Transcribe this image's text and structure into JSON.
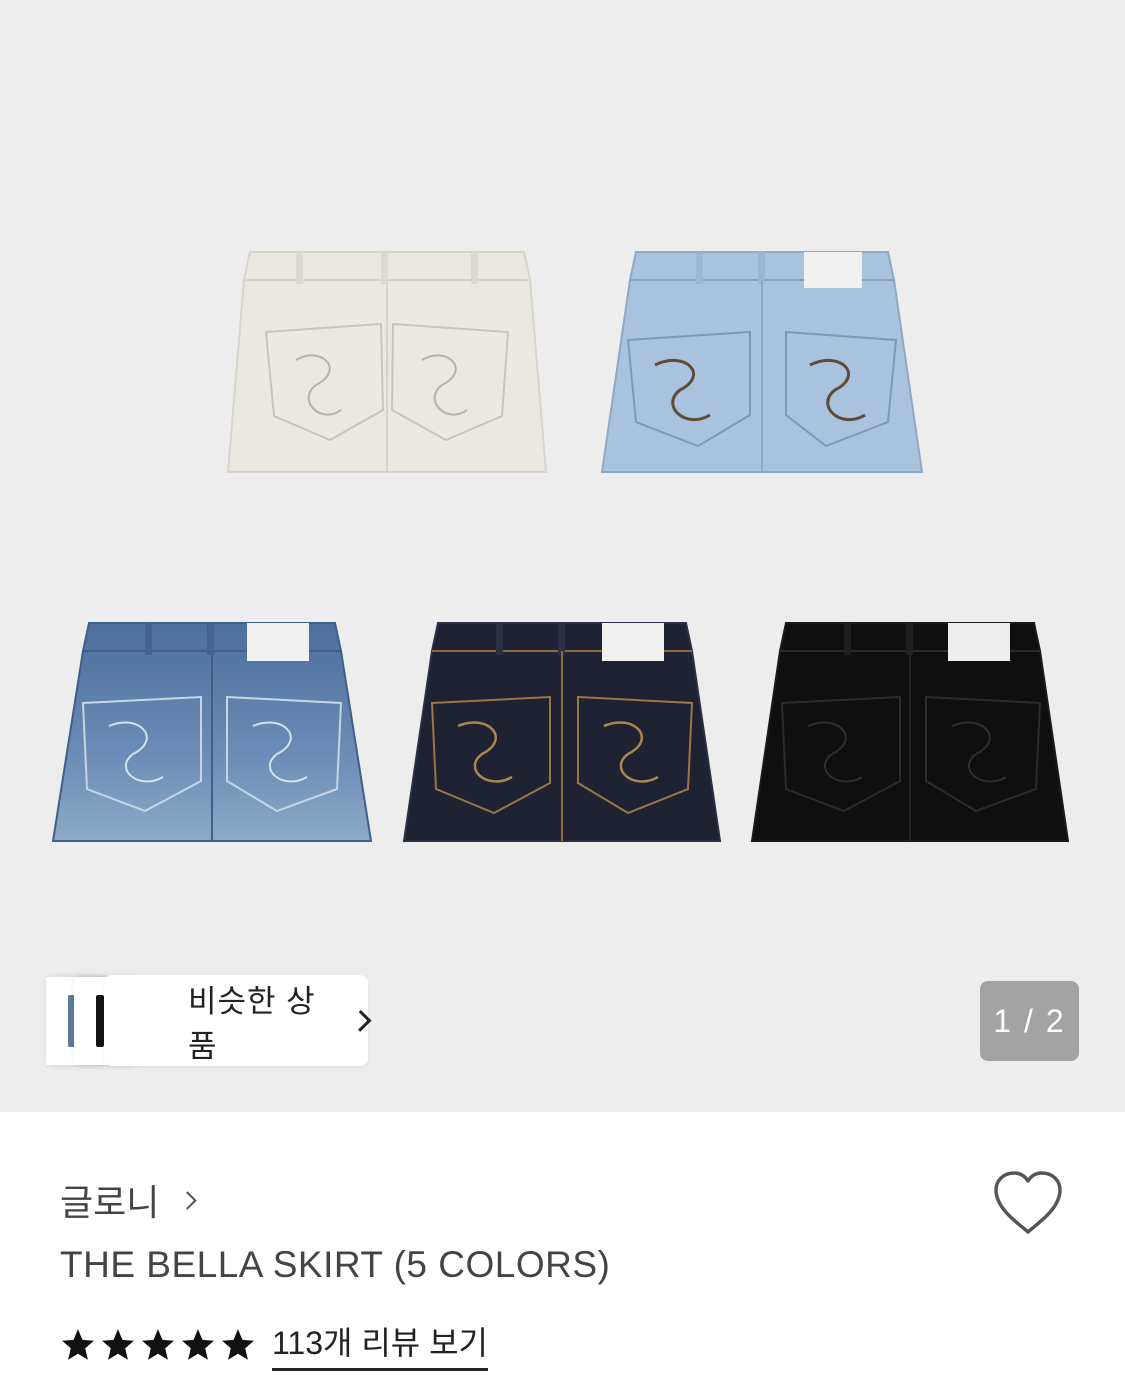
{
  "similar": {
    "label": "비슷한 상품",
    "icon": "chevron-right-icon"
  },
  "pager": {
    "text": "1 / 2",
    "current": 1,
    "total": 2
  },
  "product": {
    "brand": "글로니",
    "brand_icon": "chevron-right-icon",
    "title": "THE BELLA SKIRT (5 COLORS)",
    "wishlist_icon": "heart-icon",
    "rating_stars": 5,
    "review_link": "113개 리뷰 보기"
  },
  "colors": {
    "gallery_bg": "#ededee",
    "skirt_white": "#ebe8e2",
    "skirt_lightblue": "#a9c2de",
    "skirt_midblue": "#5f81ab",
    "skirt_navy": "#1e2233",
    "skirt_black": "#0f0f10"
  }
}
